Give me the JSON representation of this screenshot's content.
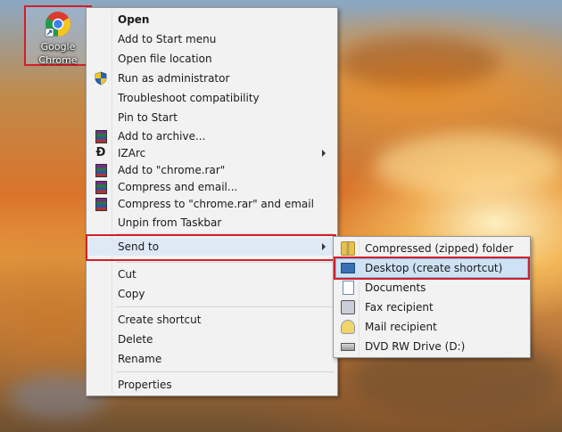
{
  "desktop": {
    "icon": {
      "label_line1": "Google",
      "label_line2": "Chrome"
    }
  },
  "context_menu": {
    "items": [
      {
        "label": "Open",
        "bold": true
      },
      {
        "label": "Add to Start menu"
      },
      {
        "label": "Open file location"
      },
      {
        "label": "Run as administrator",
        "icon": "shield-icon"
      },
      {
        "label": "Troubleshoot compatibility"
      },
      {
        "label": "Pin to Start"
      },
      {
        "label": "Add to archive...",
        "icon": "winrar-icon"
      },
      {
        "label": "IZArc",
        "icon": "izarc-icon",
        "submenu": true
      },
      {
        "label": "Add to \"chrome.rar\"",
        "icon": "winrar-icon"
      },
      {
        "label": "Compress and email...",
        "icon": "winrar-icon"
      },
      {
        "label": "Compress to \"chrome.rar\" and email",
        "icon": "winrar-icon"
      },
      {
        "label": "Unpin from Taskbar"
      },
      {
        "label": "Send to",
        "submenu": true,
        "highlighted": true
      },
      {
        "label": "Cut"
      },
      {
        "label": "Copy"
      },
      {
        "label": "Create shortcut"
      },
      {
        "label": "Delete"
      },
      {
        "label": "Rename"
      },
      {
        "label": "Properties"
      }
    ]
  },
  "send_to_menu": {
    "items": [
      {
        "label": "Compressed (zipped) folder",
        "icon": "zip-folder-icon"
      },
      {
        "label": "Desktop (create shortcut)",
        "icon": "desktop-icon",
        "highlighted": true
      },
      {
        "label": "Documents",
        "icon": "documents-icon"
      },
      {
        "label": "Fax recipient",
        "icon": "fax-icon"
      },
      {
        "label": "Mail recipient",
        "icon": "mail-icon"
      },
      {
        "label": "DVD RW Drive (D:)",
        "icon": "dvd-drive-icon"
      }
    ]
  },
  "colors": {
    "highlight_border": "#d0202a",
    "selection_fill": "#cfe2f5",
    "menu_background": "#f2f2f2"
  }
}
